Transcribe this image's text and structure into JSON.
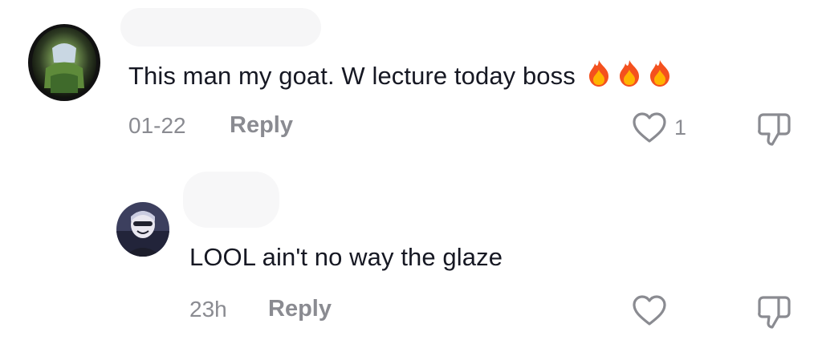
{
  "comments": [
    {
      "text": "This man my goat. W lecture today boss",
      "emojis": [
        "fire",
        "fire",
        "fire"
      ],
      "date": "01-22",
      "reply_label": "Reply",
      "like_count": "1",
      "avatar_icon": "landscape-avatar"
    },
    {
      "text": "LOOL ain't no way the glaze",
      "date": "23h",
      "reply_label": "Reply",
      "like_count": "",
      "avatar_icon": "anime-character-avatar"
    }
  ],
  "colors": {
    "text": "#161823",
    "secondary": "#8a8b91",
    "icon_stroke": "#8a8b91"
  }
}
